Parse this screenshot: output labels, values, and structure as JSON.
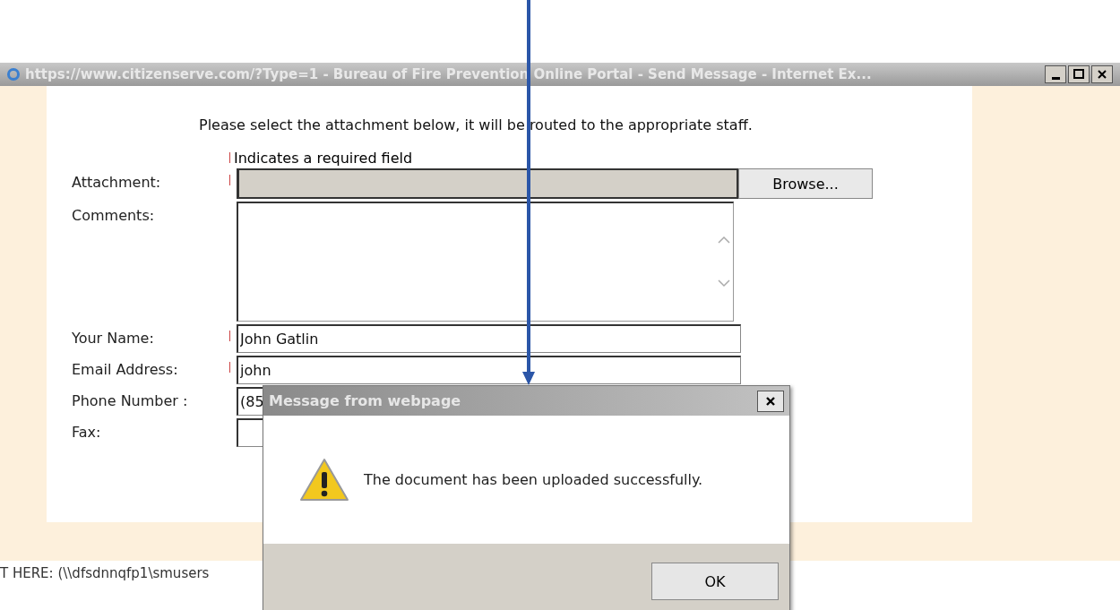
{
  "window": {
    "title": "https://www.citizenserve.com/?Type=1 - Bureau of Fire Prevention Online Portal - Send Message - Internet Ex..."
  },
  "form": {
    "intro": "Please select the attachment below, it will be routed to the appropriate staff.",
    "required_note": "Indicates a required field",
    "fields": [
      {
        "label": "Attachment:",
        "kind": "file",
        "required": true,
        "button": "Browse..."
      },
      {
        "label": "Comments:",
        "kind": "textarea",
        "required": false
      },
      {
        "label": "Your Name:",
        "kind": "text",
        "required": true,
        "value": "John Gatlin"
      },
      {
        "label": "Email Address:",
        "kind": "text",
        "required": true,
        "value": "john"
      },
      {
        "label": "Phone Number :",
        "kind": "text",
        "required": false,
        "value": "(85"
      },
      {
        "label": "Fax:",
        "kind": "text",
        "required": false
      }
    ]
  },
  "background_text": "T HERE: (\\\\dfsdnnqfp1\\smusers",
  "dialog": {
    "title": "Message from webpage",
    "message": "The document has been uploaded successfully.",
    "buttons": [
      "OK"
    ]
  }
}
